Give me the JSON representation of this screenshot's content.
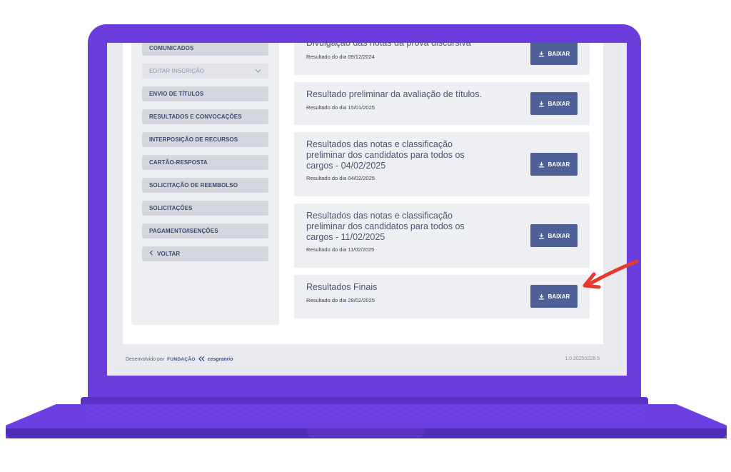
{
  "sidebar": {
    "items": [
      {
        "label": "COMUNICADOS",
        "muted": false
      },
      {
        "label": "EDITAR INSCRIÇÃO",
        "muted": true
      },
      {
        "label": "ENVIO DE TÍTULOS",
        "muted": false
      },
      {
        "label": "RESULTADOS E CONVOCAÇÕES",
        "muted": false
      },
      {
        "label": "INTERPOSIÇÃO DE RECURSOS",
        "muted": false
      },
      {
        "label": "CARTÃO-RESPOSTA",
        "muted": false
      },
      {
        "label": "SOLICITAÇÃO DE REEMBOLSO",
        "muted": false
      },
      {
        "label": "SOLICITAÇÕES",
        "muted": false
      },
      {
        "label": "PAGAMENTO/ISENÇÕES",
        "muted": false
      },
      {
        "label": "VOLTAR",
        "muted": false
      }
    ]
  },
  "results": [
    {
      "title": "Divulgação das notas da prova discursiva",
      "date": "Resultado do dia 09/12/2024",
      "button": "BAIXAR"
    },
    {
      "title": "Resultado preliminar da avaliação de títulos.",
      "date": "Resultado do dia 15/01/2025",
      "button": "BAIXAR"
    },
    {
      "title": "Resultados das notas e classificação preliminar dos candidatos para todos os cargos - 04/02/2025",
      "date": "Resultado do dia 04/02/2025",
      "button": "BAIXAR"
    },
    {
      "title": "Resultados das notas e classificação preliminar dos candidatos para todos os cargos - 11/02/2025",
      "date": "Resultado do dia 11/02/2025",
      "button": "BAIXAR"
    },
    {
      "title": "Resultados Finais",
      "date": "Resultado do dia 28/02/2025",
      "button": "BAIXAR"
    }
  ],
  "footer": {
    "developed_by": "Desenvolvido por",
    "org_prefix": "FUNDAÇÃO",
    "org_name": "cesgranrio",
    "version": "1.0.20250228.5"
  },
  "colors": {
    "laptop": "#6a3ddc",
    "button": "#4f5f98",
    "annotation_arrow": "#e8392f"
  },
  "icons": {
    "download": "download-icon",
    "chevron": "chevron-down-icon",
    "back": "chevron-left-icon"
  }
}
